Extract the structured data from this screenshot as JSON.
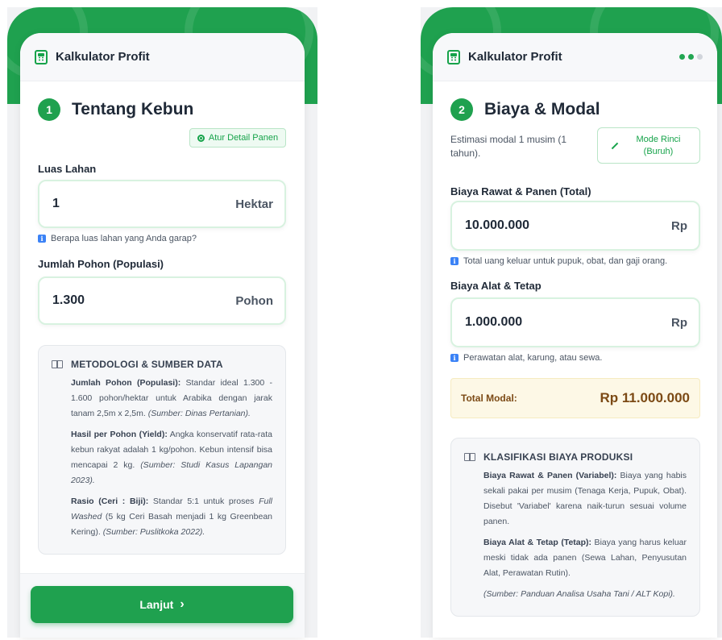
{
  "left": {
    "header_title": "Kalkulator Profit",
    "step_number": "1",
    "step_title": "Tentang Kebun",
    "detail_button": "Atur Detail Panen",
    "fields": [
      {
        "label": "Luas Lahan",
        "value": "1",
        "unit": "Hektar",
        "hint": "Berapa luas lahan yang Anda garap?"
      },
      {
        "label": "Jumlah Pohon (Populasi)",
        "value": "1.300",
        "unit": "Pohon"
      }
    ],
    "methodology": {
      "title": "METODOLOGI & SUMBER DATA",
      "items": [
        {
          "term": "Jumlah Pohon (Populasi):",
          "text": " Standar ideal 1.300 - 1.600 pohon/hektar untuk Arabika dengan jarak tanam 2,5m x 2,5m. ",
          "source": "(Sumber: Dinas Pertanian)."
        },
        {
          "term": "Hasil per Pohon (Yield):",
          "text": " Angka konservatif rata-rata kebun rakyat adalah 1 kg/pohon. Kebun intensif bisa mencapai 2 kg. ",
          "source": "(Sumber: Studi Kasus Lapangan 2023)."
        },
        {
          "term": "Rasio (Ceri : Biji):",
          "text_a": " Standar 5:1 untuk proses ",
          "em": "Full Washed",
          "text_b": " (5 kg Ceri Basah menjadi 1 kg Greenbean Kering). ",
          "source": "(Sumber: Puslitkoka 2022)."
        }
      ]
    },
    "next_button": "Lanjut",
    "next_chevron": "›"
  },
  "right": {
    "header_title": "Kalkulator Profit",
    "step_number": "2",
    "step_title": "Biaya & Modal",
    "description": "Estimasi modal 1 musim (1 tahun).",
    "mode_button": "Mode Rinci (Buruh)",
    "fields": [
      {
        "label": "Biaya Rawat & Panen (Total)",
        "value": "10.000.000",
        "unit": "Rp",
        "hint": "Total uang keluar untuk pupuk, obat, dan gaji orang."
      },
      {
        "label": "Biaya Alat & Tetap",
        "value": "1.000.000",
        "unit": "Rp",
        "hint": "Perawatan alat, karung, atau sewa."
      }
    ],
    "total": {
      "label": "Total Modal:",
      "value": "Rp 11.000.000"
    },
    "classification": {
      "title": "KLASIFIKASI BIAYA PRODUKSI",
      "items": [
        {
          "term": "Biaya Rawat & Panen (Variabel):",
          "text": " Biaya yang habis sekali pakai per musim (Tenaga Kerja, Pupuk, Obat). Disebut 'Variabel' karena naik-turun sesuai volume panen."
        },
        {
          "term": "Biaya Alat & Tetap (Tetap):",
          "text": " Biaya yang harus keluar meski tidak ada panen (Sewa Lahan, Penyusutan Alat, Perawatan Rutin)."
        }
      ],
      "source": "(Sumber: Panduan Analisa Usaha Tani / ALT Kopi)."
    }
  },
  "icons": {
    "info": "i"
  },
  "colors": {
    "primary": "#1fa14f",
    "total_bg": "#fdf8e6",
    "total_text": "#7c4a15"
  }
}
